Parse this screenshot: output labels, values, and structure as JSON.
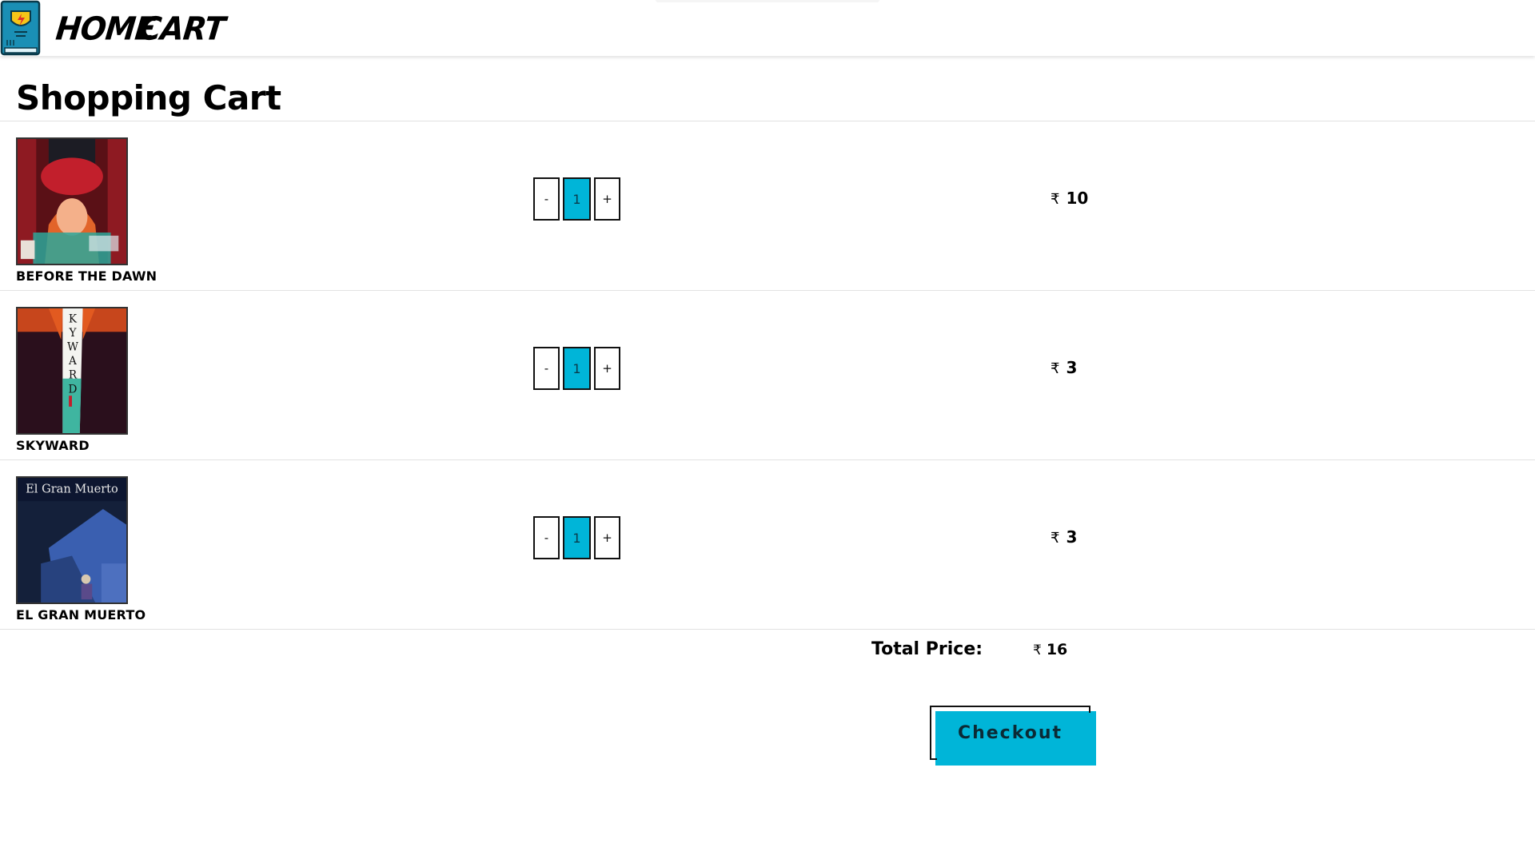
{
  "nav": {
    "home_label": "HOME",
    "cart_label": "CART",
    "logo_icon": "comic-book-logo-icon"
  },
  "page": {
    "title": "Shopping Cart"
  },
  "currency_symbol": "₹",
  "cart_items": [
    {
      "name": "BEFORE THE DAWN",
      "quantity": "1",
      "price": "10",
      "cover_icon": "book-cover-image"
    },
    {
      "name": "SKYWARD",
      "quantity": "1",
      "price": "3",
      "cover_icon": "book-cover-image"
    },
    {
      "name": "EL GRAN MUERTO",
      "quantity": "1",
      "price": "3",
      "cover_icon": "book-cover-image"
    }
  ],
  "buttons": {
    "minus": "-",
    "plus": "+"
  },
  "summary": {
    "total_label": "Total Price:",
    "total_value": "16"
  },
  "checkout": {
    "label": "Checkout"
  },
  "colors": {
    "accent": "#00b5d8",
    "logo": "#1a8fb5"
  }
}
